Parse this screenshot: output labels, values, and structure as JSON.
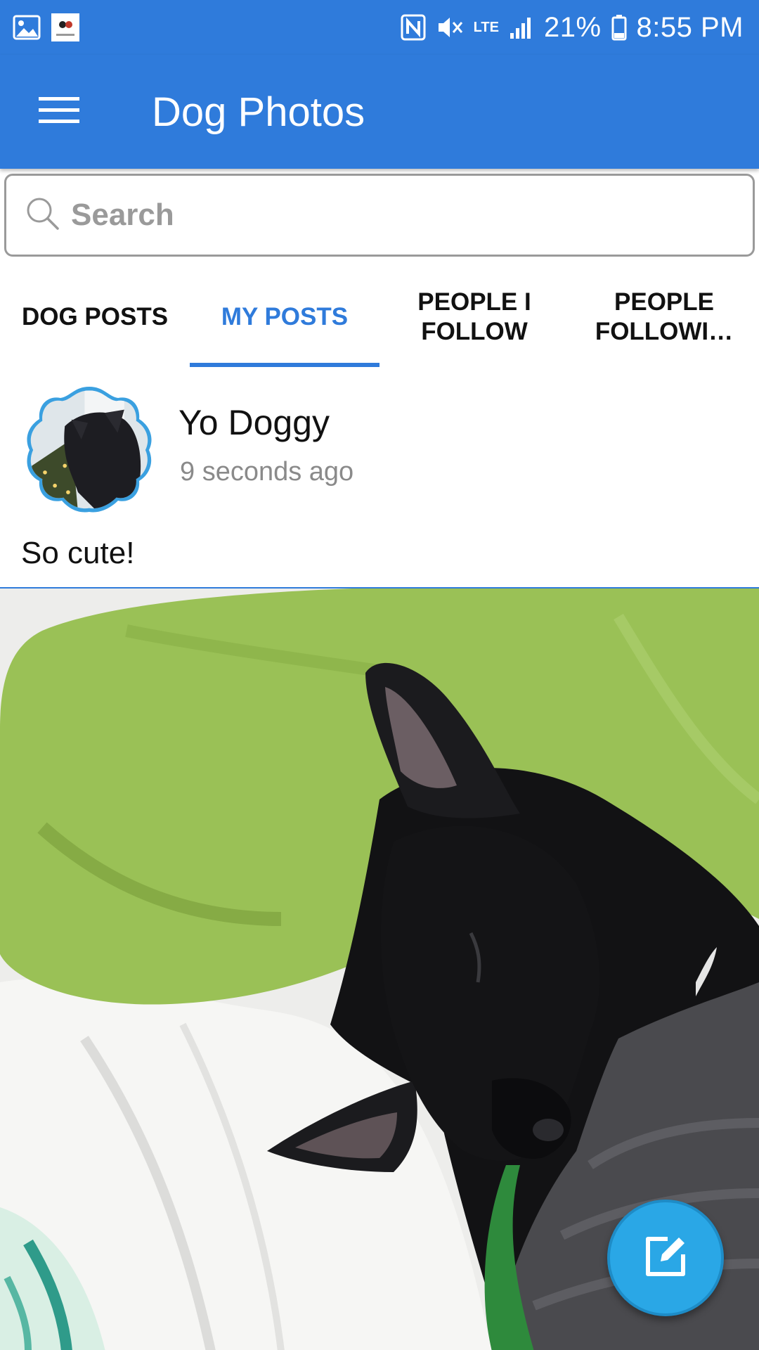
{
  "status_bar": {
    "battery": "21%",
    "time": "8:55 PM",
    "network": "LTE"
  },
  "app_bar": {
    "title": "Dog Photos"
  },
  "search": {
    "placeholder": "Search"
  },
  "tabs": [
    {
      "label": "DOG POSTS",
      "active": false
    },
    {
      "label": "MY POSTS",
      "active": true
    },
    {
      "label": "PEOPLE I FOLLOW",
      "active": false
    },
    {
      "label": "PEOPLE FOLLOWI…",
      "active": false
    }
  ],
  "post": {
    "author": "Yo Doggy",
    "time": "9 seconds ago",
    "text": "So cute!"
  },
  "colors": {
    "primary": "#2f7bdb",
    "fab": "#2aa7e6"
  },
  "icons": {
    "menu": "hamburger-icon",
    "search": "search-icon",
    "fab": "edit-icon"
  }
}
